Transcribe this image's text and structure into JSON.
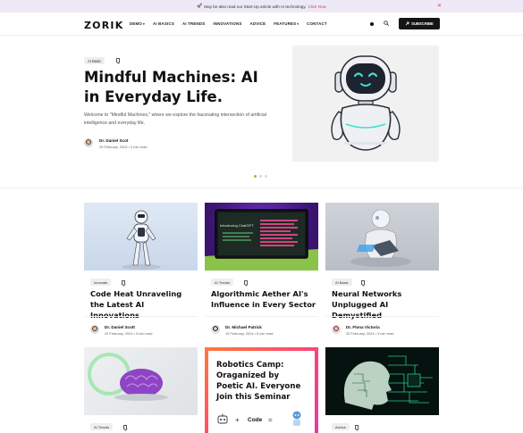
{
  "announcement": {
    "icon": "rocket-icon",
    "text": "May be also read our Start-Up article with AI technology.",
    "link": "Click Now",
    "close_icon": "close-icon"
  },
  "nav": {
    "logo": "ZORIK",
    "items": [
      {
        "label": "DEMO",
        "dropdown": true
      },
      {
        "label": "AI BASICS",
        "dropdown": false
      },
      {
        "label": "AI TRENDS",
        "dropdown": false
      },
      {
        "label": "INNOVATIONS",
        "dropdown": false
      },
      {
        "label": "ADVICE",
        "dropdown": false
      },
      {
        "label": "FEATURES",
        "dropdown": true
      },
      {
        "label": "CONTACT",
        "dropdown": false
      }
    ],
    "subscribe_label": "SUBSCRIBE"
  },
  "hero": {
    "tag": "AI Basic",
    "title": "Mindful Machines: AI in Everyday Life.",
    "description": "Welcome to \"Mindful Machines,\" where we explore the fascinating intersection of artificial intelligence and everyday life.",
    "author": "Dr. Daniel Scot",
    "date": "20 February, 2024",
    "read_time": "3 min read",
    "slides": 3,
    "active_slide": 1
  },
  "cards": [
    {
      "tag": "Innovate",
      "title": "Code Heat Unraveling the Latest AI Innovations",
      "author": "Dr. Daniel Scott",
      "date": "20 February, 2024",
      "read_time": "3 min read"
    },
    {
      "tag": "AI Trends",
      "title": "Algorithmic Aether AI's Influence in Every Sector",
      "author": "Dr. Michael Patrick",
      "date": "10 February, 2024",
      "read_time": "5 min read",
      "screen_text": "Introducing ChatGPT"
    },
    {
      "tag": "AI Basic",
      "title": "Neural Networks Unplugged AI Demystified",
      "author": "Dr. Flona Victoria",
      "date": "20 February, 2024",
      "read_time": "3 min read"
    }
  ],
  "cards_row2": [
    {
      "tag": "AI Trends"
    },
    {
      "promo_title": "Robotics Camp: Oraganized by Poetic AI. Everyone Join this Seminar",
      "promo_code": "Code"
    },
    {
      "tag": "Advice"
    }
  ],
  "colors": {
    "accent": "#e0433a",
    "announce_bg": "#ede9f7",
    "dark": "#151515",
    "active_dot": "#7ac943"
  }
}
